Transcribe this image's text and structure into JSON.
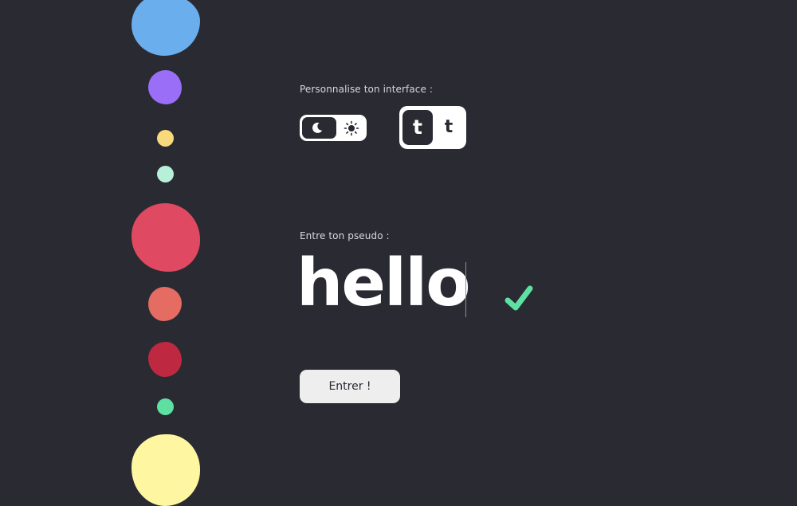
{
  "palette": {
    "background": "#292a32",
    "text": "#ffffff",
    "accent_green": "#5ee0a3"
  },
  "color_swatches": [
    {
      "name": "blue",
      "color": "#6aaeee"
    },
    {
      "name": "purple",
      "color": "#9a6ef7"
    },
    {
      "name": "yellow",
      "color": "#f8d97c"
    },
    {
      "name": "mint",
      "color": "#b7efd9"
    },
    {
      "name": "pink-red",
      "color": "#df4961"
    },
    {
      "name": "coral",
      "color": "#e56c63"
    },
    {
      "name": "crimson",
      "color": "#be2941"
    },
    {
      "name": "green",
      "color": "#5ee0a3"
    },
    {
      "name": "light-yellow",
      "color": "#fff6a1"
    }
  ],
  "customize": {
    "label": "Personnalise ton interface :",
    "theme_toggle": {
      "selected": "dark",
      "dark_icon": "moon-icon",
      "light_icon": "sun-icon"
    },
    "font_toggle": {
      "selected_glyph": "t",
      "other_glyph": "t"
    }
  },
  "pseudo": {
    "label": "Entre ton pseudo :",
    "value": "hello",
    "valid_icon": "check-icon"
  },
  "enter_button": {
    "label": "Entrer !"
  }
}
